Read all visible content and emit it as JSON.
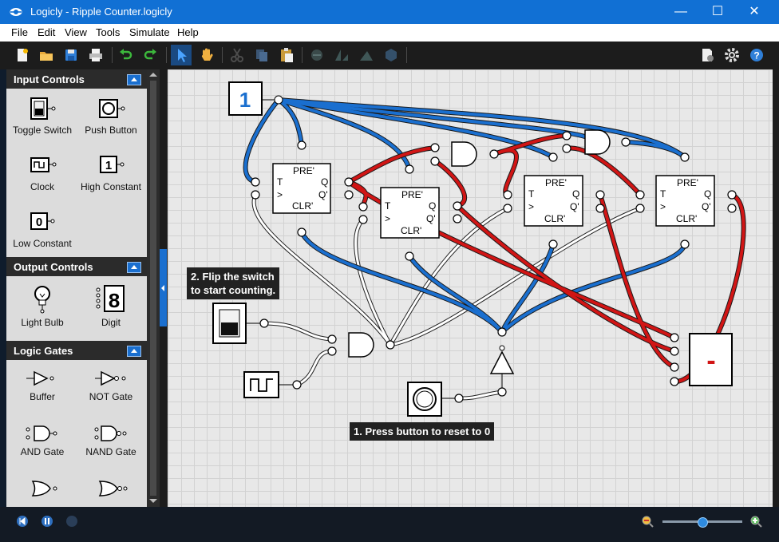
{
  "window": {
    "title": "Logicly - Ripple Counter.logicly",
    "controls": {
      "minimize": "—",
      "maximize": "☐",
      "close": "✕"
    }
  },
  "menu": [
    "File",
    "Edit",
    "View",
    "Tools",
    "Simulate",
    "Help"
  ],
  "toolbar": {
    "left_icons": [
      "new-file-icon",
      "open-folder-icon",
      "save-icon",
      "print-icon",
      "undo-icon",
      "redo-icon",
      "select-pointer-icon",
      "pan-hand-icon",
      "cut-icon",
      "copy-icon",
      "paste-icon",
      "group-icon",
      "flip-icon",
      "rotate-icon",
      "shape-icon"
    ],
    "right_icons": [
      "export-icon",
      "settings-gear-icon",
      "help-icon"
    ]
  },
  "sidebar": {
    "sections": [
      {
        "title": "Input Controls",
        "items": [
          "Toggle Switch",
          "Push Button",
          "Clock",
          "High Constant",
          "Low Constant"
        ]
      },
      {
        "title": "Output Controls",
        "items": [
          "Light Bulb",
          "Digit"
        ]
      },
      {
        "title": "Logic Gates",
        "items": [
          "Buffer",
          "NOT Gate",
          "AND Gate",
          "NAND Gate"
        ]
      }
    ]
  },
  "canvas": {
    "high_constant_value": "1",
    "flipflop_labels": {
      "pre": "PRE'",
      "clr": "CLR'",
      "t": "T",
      "clk": ">",
      "q": "Q",
      "qn": "Q'"
    },
    "callouts": {
      "flip_line1": "2. Flip the switch",
      "flip_line2": "to start counting.",
      "press": "1. Press button to reset to 0"
    },
    "digit_display": "-"
  },
  "colors": {
    "titlebar": "#1170d4",
    "wire_high": "#d11515",
    "wire_low": "#1a6fcf",
    "wire_inactive": "#ffffff",
    "accent": "#1a6fcf"
  },
  "statusbar": {
    "left_icons": [
      "rewind-icon",
      "pause-icon",
      "step-icon"
    ],
    "zoom_level": 0.5
  }
}
